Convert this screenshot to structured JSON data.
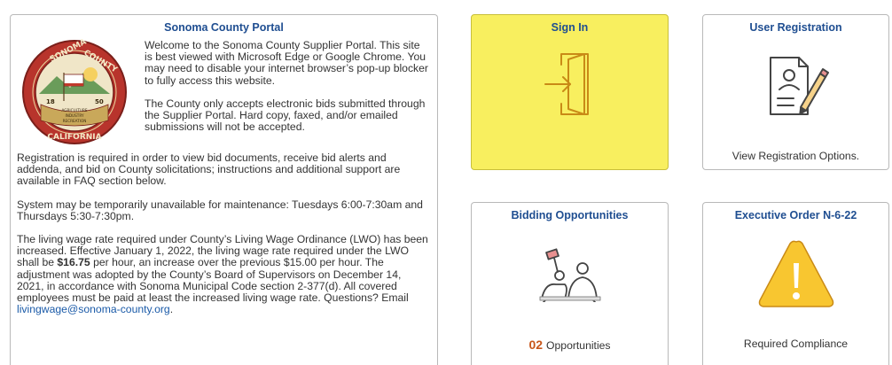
{
  "portal": {
    "title": "Sonoma County Portal",
    "seal_text": {
      "top_left": "SONOMA",
      "top_right": "COUNTY",
      "bottom": "CALIFORNIA",
      "year_left": "18",
      "year_right": "50",
      "ribbon": [
        "AGRICULTURE",
        "INDUSTRY",
        "RECREATION"
      ]
    },
    "welcome_1": "Welcome to the Sonoma County Supplier Portal. This site is best viewed with Microsoft Edge or Google Chrome. You may need to disable your internet browser’s pop-up blocker to fully access this website.",
    "welcome_2": "The County only accepts electronic bids submitted through the Supplier Portal. Hard copy, faxed, and/or emailed submissions will not be accepted.",
    "registration_text": "Registration is required in order to view bid documents, receive bid alerts and addenda, and bid on County solicitations; instructions and additional support are available in FAQ section below.",
    "maintenance_text": "System may be temporarily unavailable for maintenance: Tuesdays 6:00-7:30am and Thursdays 5:30-7:30pm.",
    "wage_pre": "The living wage rate required under County’s Living Wage Ordinance (LWO) has been increased. Effective January 1, 2022, the living wage rate required under the LWO shall be ",
    "wage_amount": "$16.75",
    "wage_post": " per hour, an increase over the previous $15.00 per hour. The adjustment was adopted by the County’s Board of Supervisors on December 14, 2021, in accordance with Sonoma Municipal Code section 2-377(d). All covered employees must be paid at least the increased living wage rate. Questions? Email ",
    "wage_email": "livingwage@sonoma-county.org",
    "wage_end": "."
  },
  "tiles": {
    "signin": {
      "title": "Sign In",
      "icon": "sign-in-door-icon",
      "bg_color": "#f8ef5f"
    },
    "registration": {
      "title": "User Registration",
      "icon": "registration-form-pencil-icon",
      "footer": "View Registration Options."
    },
    "bidding": {
      "title": "Bidding Opportunities",
      "icon": "bidding-people-icon",
      "count": "02",
      "footer": "Opportunities"
    },
    "exec": {
      "title": "Executive Order N-6-22",
      "icon": "warning-triangle-icon",
      "footer": "Required Compliance"
    }
  },
  "colors": {
    "title_blue": "#1f4e91",
    "link_blue": "#1a5aa8",
    "count_orange": "#c8561a",
    "warning_yellow": "#f8c630"
  }
}
